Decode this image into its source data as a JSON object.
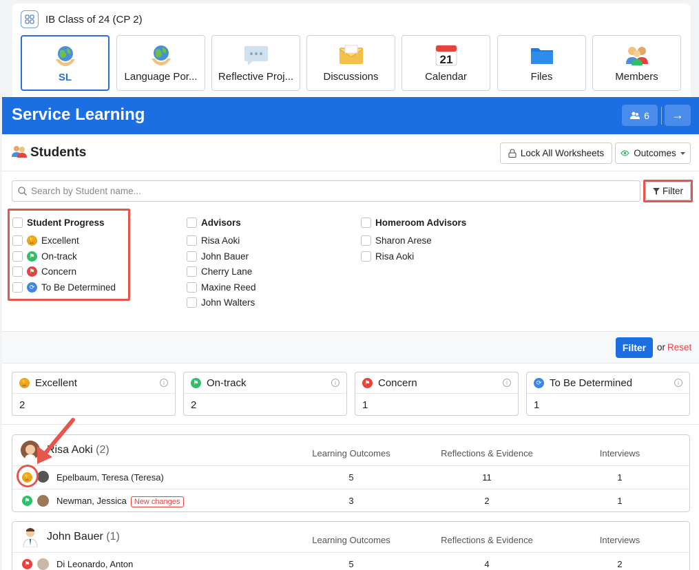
{
  "header": {
    "title": "IB Class of 24 (CP 2)"
  },
  "tabs": [
    {
      "label": "SL",
      "icon": "globe-hands-icon"
    },
    {
      "label": "Language Por...",
      "icon": "globe-hands-icon"
    },
    {
      "label": "Reflective Proj...",
      "icon": "speech-bubble-icon"
    },
    {
      "label": "Discussions",
      "icon": "envelope-icon"
    },
    {
      "label": "Calendar",
      "icon": "calendar-icon",
      "day": "21"
    },
    {
      "label": "Files",
      "icon": "folder-icon"
    },
    {
      "label": "Members",
      "icon": "members-icon"
    }
  ],
  "banner": {
    "title": "Service Learning",
    "member_count": "6",
    "arrow": "→"
  },
  "students": {
    "title": "Students",
    "lock_label": "Lock All Worksheets",
    "outcomes_label": "Outcomes",
    "search_placeholder": "Search by Student name...",
    "filter_label": "Filter"
  },
  "filters": {
    "progress": {
      "title": "Student Progress",
      "items": [
        "Excellent",
        "On-track",
        "Concern",
        "To Be Determined"
      ]
    },
    "advisors": {
      "title": "Advisors",
      "items": [
        "Risa Aoki",
        "John Bauer",
        "Cherry Lane",
        "Maxine Reed",
        "John Walters"
      ]
    },
    "homeroom": {
      "title": "Homeroom Advisors",
      "items": [
        "Sharon Arese",
        "Risa Aoki"
      ]
    },
    "apply_label": "Filter",
    "or_label": "or",
    "reset_label": "Reset"
  },
  "stats": [
    {
      "label": "Excellent",
      "value": "2",
      "color": "#e9a41c"
    },
    {
      "label": "On-track",
      "value": "2",
      "color": "#2fbf6a"
    },
    {
      "label": "Concern",
      "value": "1",
      "color": "#e4443d"
    },
    {
      "label": "To Be Determined",
      "value": "1",
      "color": "#3d86e8"
    }
  ],
  "columns": {
    "outcomes": "Learning Outcomes",
    "reflections": "Reflections & Evidence",
    "interviews": "Interviews"
  },
  "groups": [
    {
      "name": "Risa Aoki",
      "count": "(2)",
      "rows": [
        {
          "name": "Epelbaum, Teresa (Teresa)",
          "status": "excellent",
          "outcomes": "5",
          "reflections": "11",
          "interviews": "1"
        },
        {
          "name": "Newman, Jessica",
          "status": "on-track",
          "badge": "New changes",
          "outcomes": "3",
          "reflections": "2",
          "interviews": "1"
        }
      ]
    },
    {
      "name": "John Bauer",
      "count": "(1)",
      "rows": [
        {
          "name": "Di Leonardo, Anton",
          "status": "concern",
          "outcomes": "5",
          "reflections": "4",
          "interviews": "2"
        }
      ]
    }
  ]
}
